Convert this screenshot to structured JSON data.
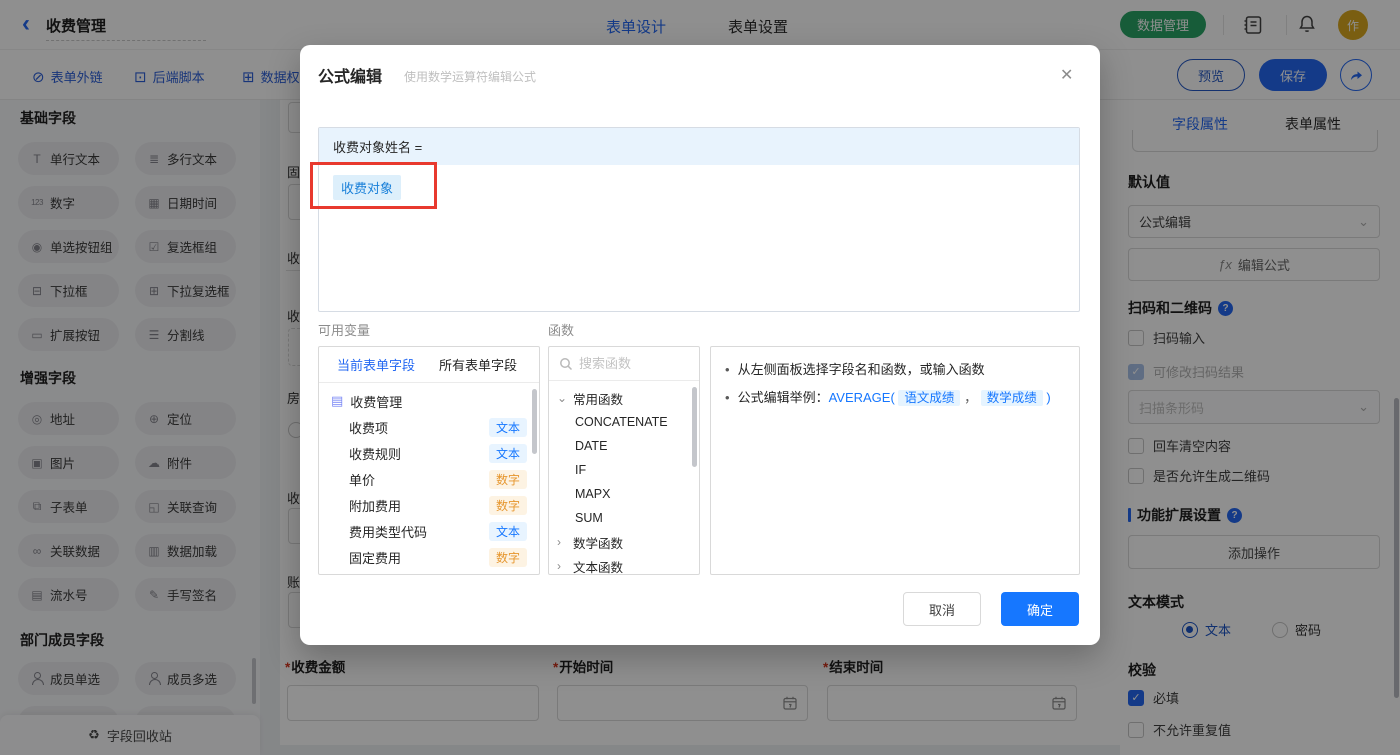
{
  "icons": {
    "back": "‹",
    "link": "⊘",
    "script": "⊡",
    "data_perm": "⊞",
    "close": "✕",
    "doc": "▤",
    "recycle": "♻",
    "chevron_down": "⌄",
    "chevron_right": "›",
    "select_chevron": "⌄",
    "fx": "ƒx",
    "help": "?"
  },
  "topnav": {
    "title": "收费管理",
    "tabs": [
      {
        "label": "表单设计"
      },
      {
        "label": "表单设置"
      }
    ],
    "data_manage_button": "数据管理",
    "avatar_text": "作"
  },
  "toolbar": {
    "links": [
      {
        "label": "表单外链"
      },
      {
        "label": "后端脚本"
      },
      {
        "label": "数据权"
      }
    ],
    "preview_button": "预览",
    "save_button": "保存"
  },
  "sidebar": {
    "sections": [
      {
        "title": "基础字段",
        "items": [
          {
            "label": "单行文本",
            "glyph": "T"
          },
          {
            "label": "多行文本",
            "glyph": "≣"
          },
          {
            "label": "数字",
            "glyph": "123"
          },
          {
            "label": "日期时间",
            "glyph": "▦"
          },
          {
            "label": "单选按钮组",
            "glyph": "◉"
          },
          {
            "label": "复选框组",
            "glyph": "☑"
          },
          {
            "label": "下拉框",
            "glyph": "⊟"
          },
          {
            "label": "下拉复选框",
            "glyph": "⊞"
          },
          {
            "label": "扩展按钮",
            "glyph": "▭"
          },
          {
            "label": "分割线",
            "glyph": "☰"
          }
        ]
      },
      {
        "title": "增强字段",
        "items": [
          {
            "label": "地址",
            "glyph": "◎"
          },
          {
            "label": "定位",
            "glyph": "⊕"
          },
          {
            "label": "图片",
            "glyph": "▣"
          },
          {
            "label": "附件",
            "glyph": "☁"
          },
          {
            "label": "子表单",
            "glyph": "⧉"
          },
          {
            "label": "关联查询",
            "glyph": "◱"
          },
          {
            "label": "关联数据",
            "glyph": "∞"
          },
          {
            "label": "数据加载",
            "glyph": "▥"
          },
          {
            "label": "流水号",
            "glyph": "▤"
          },
          {
            "label": "手写签名",
            "glyph": "✎"
          }
        ]
      },
      {
        "title": "部门成员字段",
        "items": [
          {
            "label": "成员单选",
            "glyph": ""
          },
          {
            "label": "成员多选",
            "glyph": ""
          }
        ]
      }
    ],
    "recycle_bin_label": "字段回收站"
  },
  "canvas": {
    "partial_labels": [
      "固",
      "收",
      "收",
      "房",
      "收",
      "账"
    ],
    "fields": [
      {
        "required": "*",
        "label": "收费金额"
      },
      {
        "required": "*",
        "label": "开始时间"
      },
      {
        "required": "*",
        "label": "结束时间"
      }
    ]
  },
  "modal": {
    "title": "公式编辑",
    "subtitle": "使用数学运算符编辑公式",
    "formula": {
      "target": "收费对象姓名 =",
      "chip": "收费对象"
    },
    "variables": {
      "label": "可用变量",
      "tabs": [
        {
          "label": "当前表单字段"
        },
        {
          "label": "所有表单字段"
        }
      ],
      "root": "收费管理",
      "fields": [
        {
          "name": "收费项",
          "type": "文本"
        },
        {
          "name": "收费规则",
          "type": "文本"
        },
        {
          "name": "单价",
          "type": "数字"
        },
        {
          "name": "附加费用",
          "type": "数字"
        },
        {
          "name": "费用类型代码",
          "type": "文本"
        },
        {
          "name": "固定费用",
          "type": "数字"
        }
      ]
    },
    "functions": {
      "label": "函数",
      "search_placeholder": "搜索函数",
      "group_common": "常用函数",
      "common_items": [
        "CONCATENATE",
        "DATE",
        "IF",
        "MAPX",
        "SUM"
      ],
      "group_math": "数学函数",
      "group_text": "文本函数"
    },
    "help": {
      "tip1": "从左侧面板选择字段名和函数，或输入函数",
      "tip2_prefix": "公式编辑举例：",
      "tip2_func": "AVERAGE(",
      "tip2_chip1": "语文成绩",
      "tip2_comma": "，",
      "tip2_chip2": "数学成绩",
      "tip2_close": ")"
    },
    "cancel_button": "取消",
    "confirm_button": "确定"
  },
  "right_panel": {
    "tabs": [
      {
        "label": "字段属性"
      },
      {
        "label": "表单属性"
      }
    ],
    "default_value": {
      "label": "默认值",
      "select_value": "公式编辑",
      "edit_formula_button": "编辑公式"
    },
    "scan_section": {
      "title": "扫码和二维码",
      "cb_scan_input": "扫码输入",
      "cb_modify_result": "可修改扫码结果",
      "select_value": "扫描条形码",
      "cb_enter_clear": "回车清空内容",
      "cb_allow_qrcode": "是否允许生成二维码"
    },
    "extension_section": {
      "title": "功能扩展设置",
      "add_button": "添加操作"
    },
    "text_mode": {
      "title": "文本模式",
      "option_text": "文本",
      "option_password": "密码"
    },
    "validation": {
      "title": "校验",
      "cb_required": "必填",
      "cb_no_duplicate": "不允许重复值"
    }
  },
  "colors": {
    "primary": "#2468f2",
    "confirm": "#1677ff",
    "green": "#2aa566",
    "gold": "#d9a81f",
    "annotation_red": "#e8392e"
  }
}
